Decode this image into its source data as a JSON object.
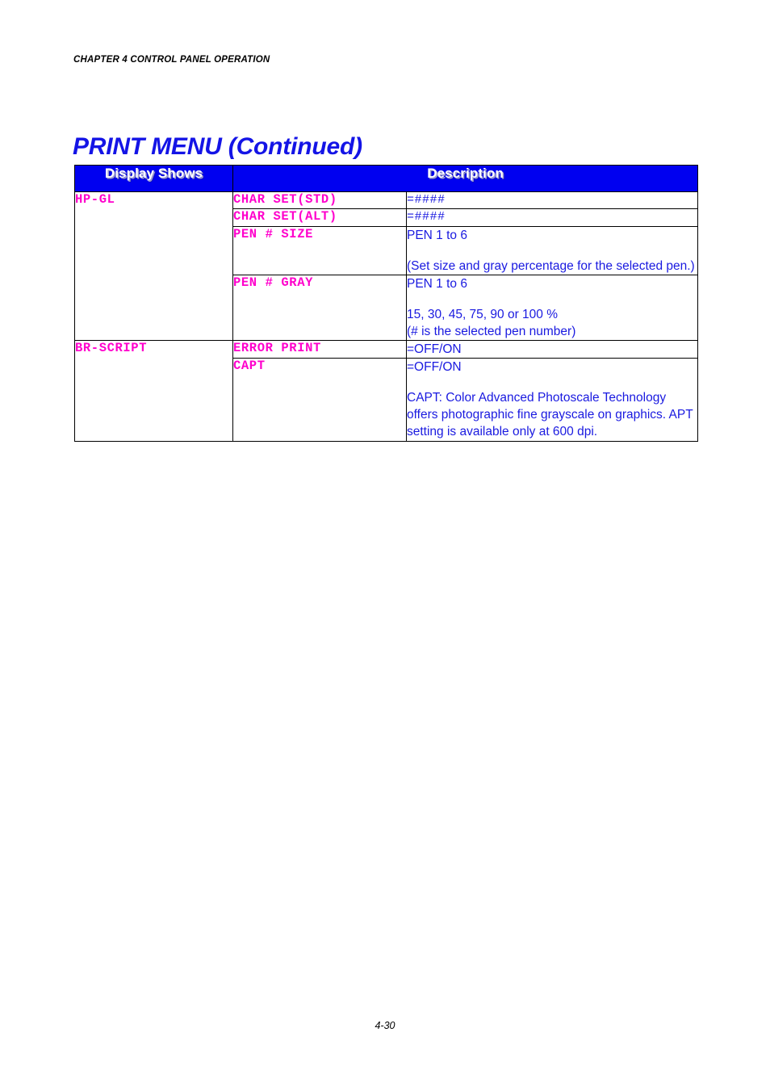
{
  "document": {
    "chapter_header": "CHAPTER 4 CONTROL PANEL OPERATION",
    "title": "PRINT MENU (Continued)",
    "page_number": "4-30"
  },
  "colors": {
    "title_blue": "#1414e6",
    "header_bg_blue": "#0000f0",
    "header_text": "#ffffff",
    "key_magenta": "#ff00cc",
    "body_blue": "#1a1ae0"
  },
  "table": {
    "headers": {
      "col1": "Display Shows",
      "col2": "Description"
    },
    "groups": [
      {
        "name": "HP-GL",
        "rows": [
          {
            "key": "CHAR SET(STD)",
            "lines": [
              "=####"
            ]
          },
          {
            "key": "CHAR SET(ALT)",
            "lines": [
              "=####"
            ]
          },
          {
            "key": "PEN # SIZE",
            "lines": [
              "PEN 1 to 6",
              "(Set size and gray percentage for the selected pen.)"
            ]
          },
          {
            "key": "PEN # GRAY",
            "lines": [
              "PEN 1 to 6",
              "15, 30, 45, 75, 90 or 100 %\n(# is the selected pen number)"
            ]
          }
        ]
      },
      {
        "name": "BR-SCRIPT",
        "rows": [
          {
            "key": "ERROR PRINT",
            "lines": [
              "=OFF/ON"
            ]
          },
          {
            "key": "CAPT",
            "lines": [
              "=OFF/ON",
              "CAPT: Color Advanced Photoscale Technology offers photographic fine grayscale on graphics. APT setting is available only at 600 dpi."
            ]
          }
        ]
      }
    ]
  }
}
